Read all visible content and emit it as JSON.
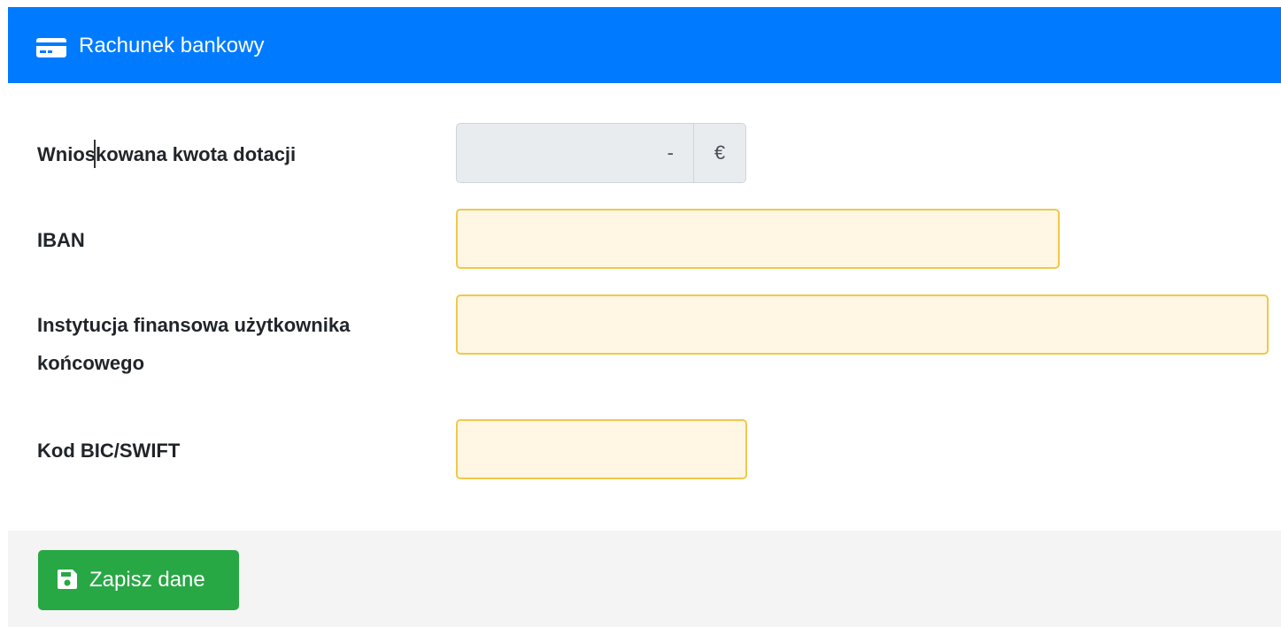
{
  "header": {
    "title": "Rachunek bankowy",
    "icon": "credit-card-icon",
    "background": "#007bff"
  },
  "form": {
    "amount": {
      "label": "Wnioskowana kwota dotacji",
      "value": "-",
      "currency": "€"
    },
    "iban": {
      "label": "IBAN",
      "value": ""
    },
    "institution": {
      "label_line1": "Instytucja finansowa użytkownika",
      "label_line2": "końcowego",
      "value": ""
    },
    "bic": {
      "label": "Kod BIC/SWIFT",
      "value": ""
    }
  },
  "footer": {
    "save_label": "Zapisz dane",
    "save_icon": "floppy-disk-icon",
    "save_color": "#28a745"
  }
}
